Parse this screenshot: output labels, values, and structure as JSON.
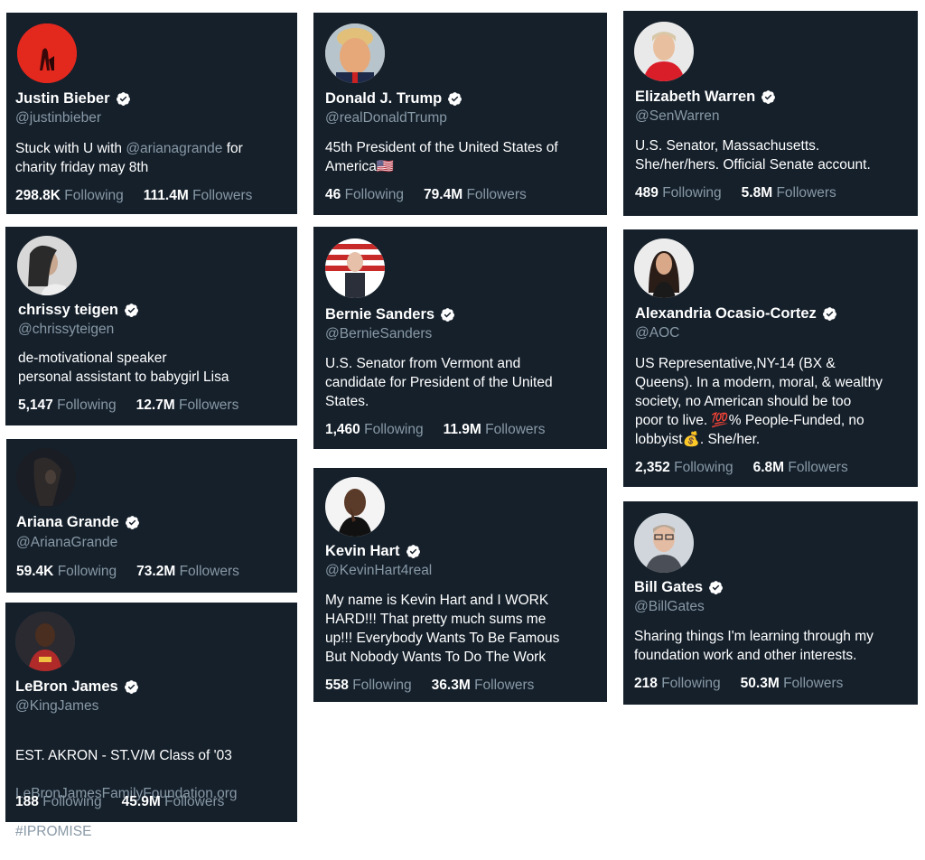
{
  "verified_icon": "verified-badge-icon",
  "colors": {
    "card_bg": "#15202b",
    "muted": "#8899a6",
    "text": "#ffffff"
  },
  "cards": [
    {
      "name": "Justin Bieber",
      "handle": "@justinbieber",
      "bio_pre": "Stuck with U with ",
      "bio_mention": "@arianagrande",
      "bio_post": " for\ncharity friday may 8th",
      "following": "298.8K",
      "following_label": "Following",
      "followers": "111.4M",
      "followers_label": "Followers"
    },
    {
      "name": "Donald J. Trump",
      "handle": "@realDonaldTrump",
      "bio": "45th President of the United States of\nAmerica🇺🇸",
      "following": "46",
      "following_label": "Following",
      "followers": "79.4M",
      "followers_label": "Followers"
    },
    {
      "name": "Elizabeth Warren",
      "handle": "@SenWarren",
      "bio": "U.S. Senator, Massachusetts.\nShe/her/hers. Official Senate account.",
      "following": "489",
      "following_label": "Following",
      "followers": "5.8M",
      "followers_label": "Followers"
    },
    {
      "name": "chrissy teigen",
      "handle": "@chrissyteigen",
      "bio": "de-motivational speaker\npersonal assistant to babygirl Lisa",
      "following": "5,147",
      "following_label": "Following",
      "followers": "12.7M",
      "followers_label": "Followers"
    },
    {
      "name": "Bernie Sanders",
      "handle": "@BernieSanders",
      "bio": "U.S. Senator from Vermont and\ncandidate for President of the United\nStates.",
      "following": "1,460",
      "following_label": "Following",
      "followers": "11.9M",
      "followers_label": "Followers"
    },
    {
      "name": "Alexandria Ocasio-Cortez",
      "handle": "@AOC",
      "bio": "US Representative,NY-14 (BX &\nQueens). In a modern, moral, & wealthy\nsociety, no American should be too\npoor to live. 💯% People-Funded, no\nlobbyist💰. She/her.",
      "following": "2,352",
      "following_label": "Following",
      "followers": "6.8M",
      "followers_label": "Followers"
    },
    {
      "name": "Ariana Grande",
      "handle": "@ArianaGrande",
      "following": "59.4K",
      "following_label": "Following",
      "followers": "73.2M",
      "followers_label": "Followers"
    },
    {
      "name": "Kevin Hart",
      "handle": "@KevinHart4real",
      "bio": "My name is Kevin Hart and I WORK\nHARD!!! That pretty much sums me\nup!!! Everybody Wants To Be Famous\nBut Nobody Wants To Do The Work",
      "following": "558",
      "following_label": "Following",
      "followers": "36.3M",
      "followers_label": "Followers"
    },
    {
      "name": "Bill Gates",
      "handle": "@BillGates",
      "bio": "Sharing things I'm learning through my\nfoundation work and other interests.",
      "following": "218",
      "following_label": "Following",
      "followers": "50.3M",
      "followers_label": "Followers"
    },
    {
      "name": "LeBron James",
      "handle": "@KingJames",
      "bio_line1": "EST. AKRON - ST.V/M Class of '03",
      "bio_link": "LeBronJamesFamilyFoundation.org",
      "bio_tag": "#IPROMISE",
      "following": "188",
      "following_label": "Following",
      "followers": "45.9M",
      "followers_label": "Followers"
    }
  ]
}
